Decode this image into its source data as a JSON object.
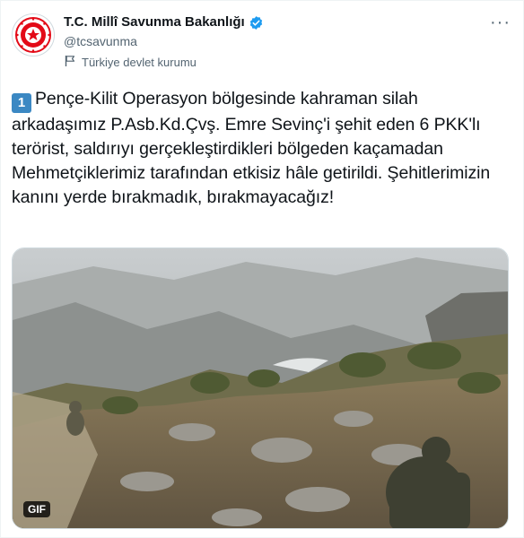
{
  "account": {
    "display_name": "T.C. Millî Savunma Bakanlığı",
    "handle": "@tcsavunma",
    "label": "Türkiye devlet kurumu",
    "verified": true
  },
  "menu": {
    "more_label": "···"
  },
  "tweet": {
    "keycap": "1",
    "text": "Pençe-Kilit Operasyon bölgesinde kahraman silah arkadaşımız P.Asb.Kd.Çvş. Emre Sevinç'i şehit eden 6 PKK'lı terörist, saldırıyı gerçekleştirdikleri bölgeden kaçamadan Mehmetçiklerimiz tarafından etkisiz hâle getirildi. Şehitlerimizin kanını yerde bırakmadık, bırakmayacağız!"
  },
  "media": {
    "type": "gif",
    "badge": "GIF"
  },
  "colors": {
    "verified_blue": "#1d9bf0",
    "keycap_blue": "#3b88c3",
    "text": "#0f1419",
    "muted": "#536471",
    "emblem_red": "#e30a17"
  },
  "icons": {
    "avatar": "ministry-emblem-icon",
    "verified": "verified-badge-icon",
    "label": "flag-icon",
    "more": "more-icon"
  }
}
